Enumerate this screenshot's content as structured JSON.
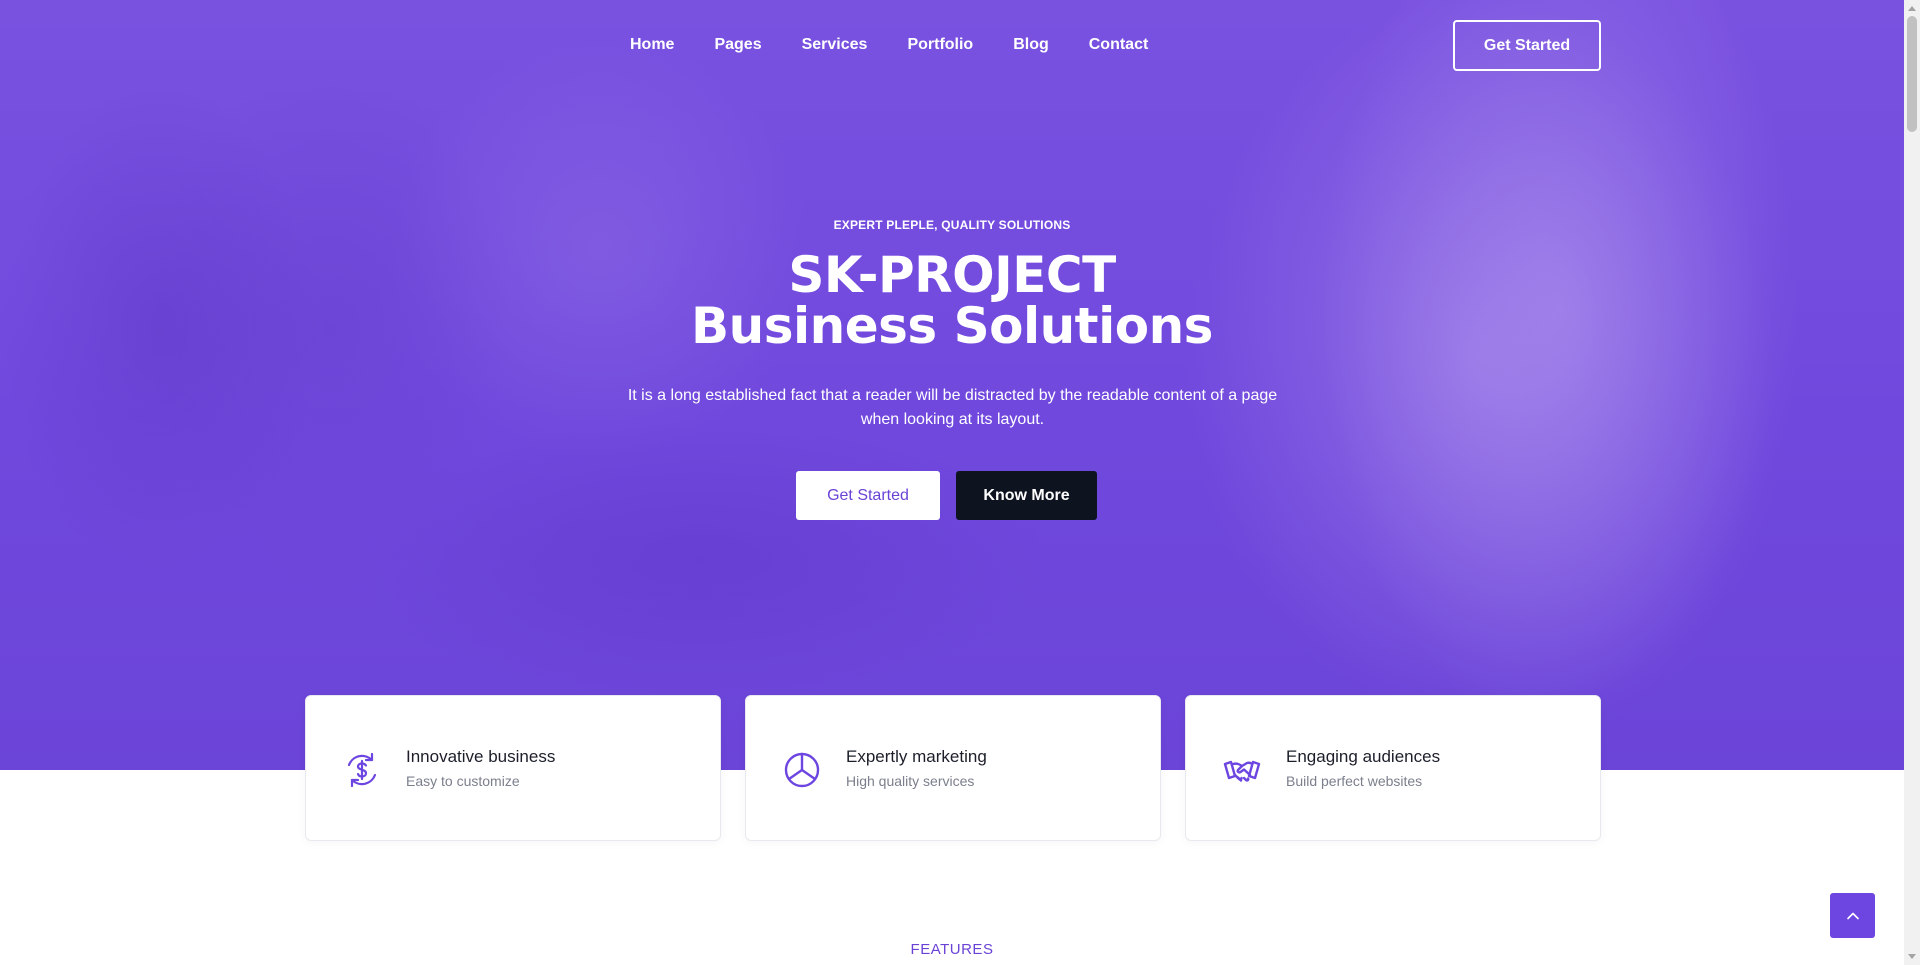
{
  "nav": {
    "links": [
      "Home",
      "Pages",
      "Services",
      "Portfolio",
      "Blog",
      "Contact"
    ],
    "cta_label": "Get Started"
  },
  "hero": {
    "eyebrow": "EXPERT PLEPLE, QUALITY SOLUTIONS",
    "title_line1": "SK-PROJECT",
    "title_line2": "Business Solutions",
    "description": "It is a long established fact that a reader will be distracted by the readable content of a page when looking at its layout.",
    "primary_button": "Get Started",
    "secondary_button": "Know More"
  },
  "cards": [
    {
      "icon": "dollar-refresh-icon",
      "title": "Innovative business",
      "subtitle": "Easy to customize"
    },
    {
      "icon": "pie-chart-icon",
      "title": "Expertly marketing",
      "subtitle": "High quality services"
    },
    {
      "icon": "handshake-icon",
      "title": "Engaging audiences",
      "subtitle": "Build perfect websites"
    }
  ],
  "features_label": "FEATURES",
  "colors": {
    "accent": "#6d45e0",
    "hero_bg": "#7048dd",
    "dark_button": "#0e1320"
  }
}
